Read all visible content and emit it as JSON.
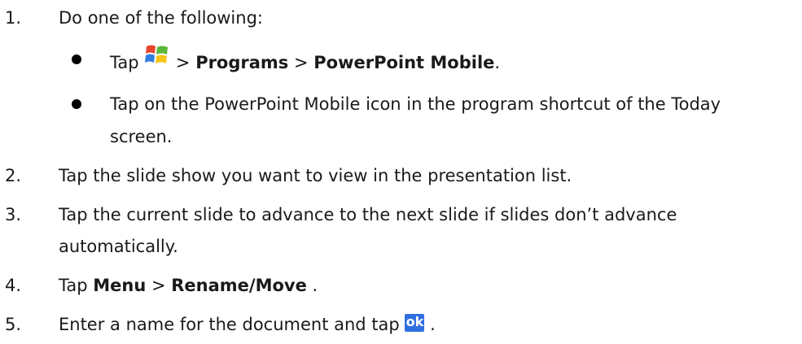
{
  "steps": [
    {
      "num": "1.",
      "text": "Do one of the following:"
    },
    {
      "num": "2.",
      "text": "Tap the slide show you want to view in the presentation list."
    },
    {
      "num": "3.",
      "line1": "Tap the current slide to advance to the next slide if slides don’t advance",
      "line2": "automatically."
    },
    {
      "num": "4.",
      "pre": "Tap ",
      "menu": "Menu",
      "sep": " > ",
      "rename": "Rename/Move",
      "post": " ."
    },
    {
      "num": "5.",
      "pre": "Enter a name for the document and tap ",
      "post": " ."
    }
  ],
  "bullets": [
    {
      "pre": "Tap ",
      "sep1": " > ",
      "programs": "Programs",
      "sep2": " > ",
      "app": "PowerPoint Mobile",
      "post": "."
    },
    {
      "line1": "Tap on the PowerPoint Mobile icon in the program shortcut of the Today",
      "line2": "screen."
    }
  ],
  "icons": {
    "start": "windows-start-flag-icon",
    "ok": "ok-icon",
    "ok_label": "ok"
  }
}
